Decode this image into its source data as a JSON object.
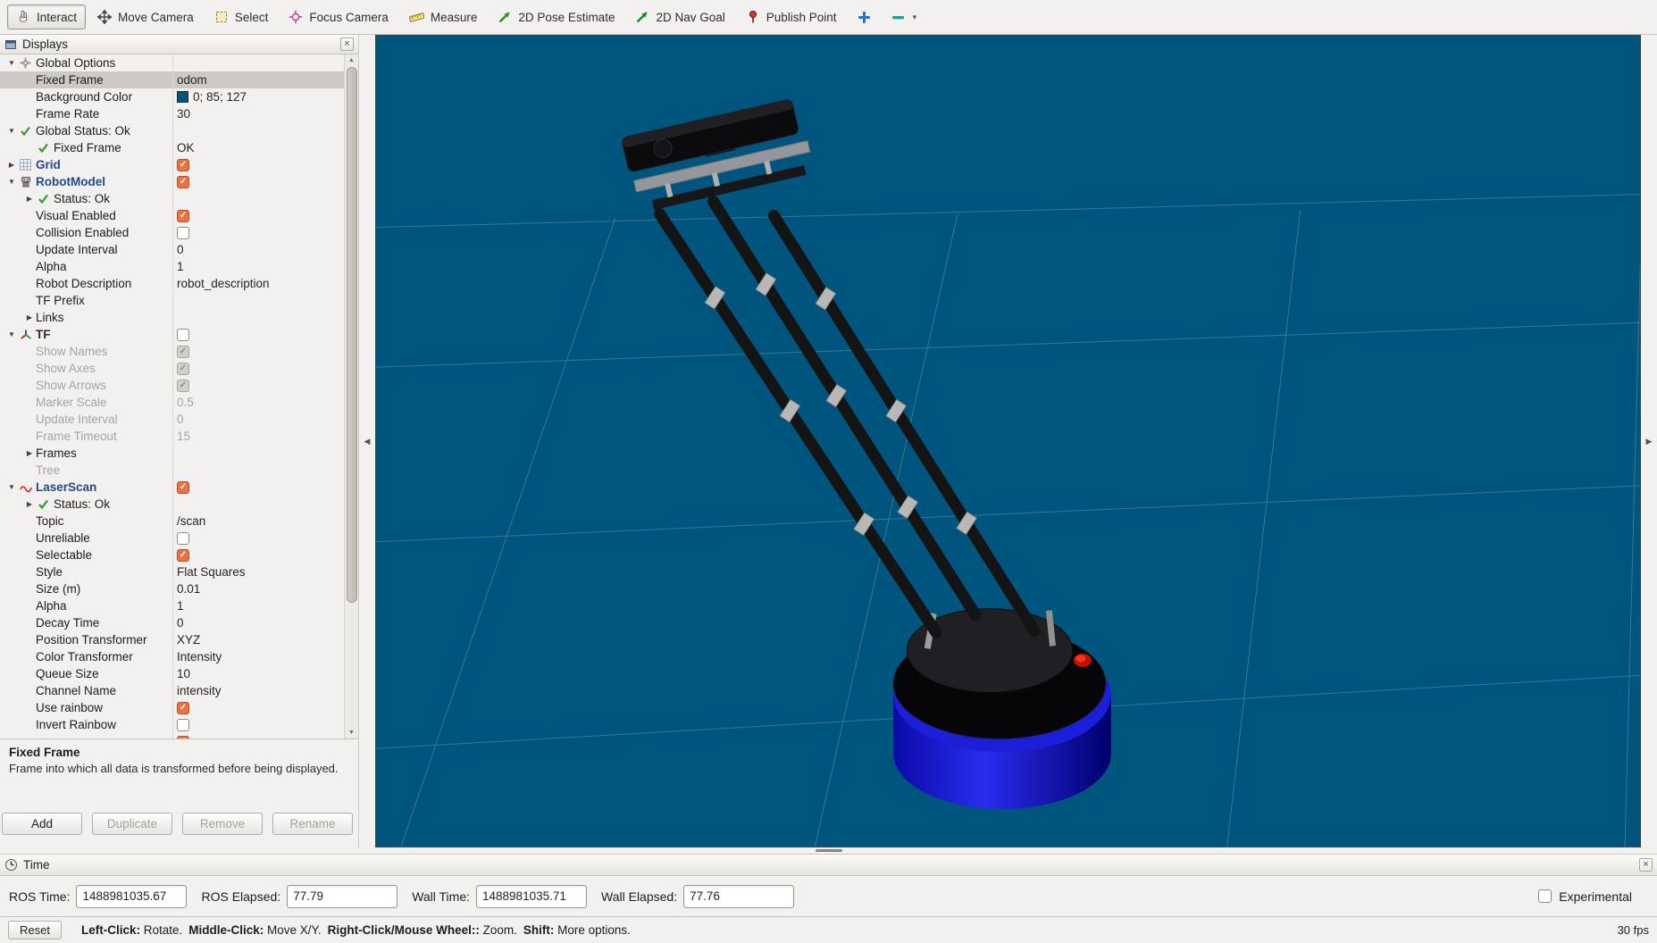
{
  "toolbar": {
    "items": [
      {
        "label": "Interact",
        "icon": "interact-icon",
        "active": true
      },
      {
        "label": "Move Camera",
        "icon": "move-camera-icon"
      },
      {
        "label": "Select",
        "icon": "select-icon"
      },
      {
        "label": "Focus Camera",
        "icon": "focus-camera-icon"
      },
      {
        "label": "Measure",
        "icon": "measure-icon"
      },
      {
        "label": "2D Pose Estimate",
        "icon": "pose-estimate-arrow-icon"
      },
      {
        "label": "2D Nav Goal",
        "icon": "nav-goal-arrow-icon"
      },
      {
        "label": "Publish Point",
        "icon": "publish-point-icon"
      },
      {
        "label": "",
        "icon": "plus-icon"
      },
      {
        "label": "",
        "icon": "minus-icon",
        "dropdown": true
      }
    ]
  },
  "displays_panel": {
    "title": "Displays",
    "rows": [
      {
        "indent": 0,
        "twisty": "open",
        "icon": "gear-icon",
        "label": "Global Options",
        "value": null
      },
      {
        "indent": 1,
        "label": "Fixed Frame",
        "value": {
          "text": "odom"
        },
        "selected": true
      },
      {
        "indent": 1,
        "label": "Background Color",
        "value": {
          "swatch": "#00557f",
          "text": "0; 85; 127"
        }
      },
      {
        "indent": 1,
        "label": "Frame Rate",
        "value": {
          "text": "30"
        }
      },
      {
        "indent": 0,
        "twisty": "open",
        "icon": "check-icon",
        "label": "Global Status: Ok",
        "value": null
      },
      {
        "indent": 1,
        "icon": "check-icon",
        "label": "Fixed Frame",
        "value": {
          "text": "OK"
        }
      },
      {
        "indent": 0,
        "twisty": "closed",
        "icon": "grid-icon",
        "label": "Grid",
        "style": "display",
        "value": {
          "checkbox": true
        }
      },
      {
        "indent": 0,
        "twisty": "open",
        "icon": "robot-icon",
        "label": "RobotModel",
        "style": "display",
        "value": {
          "checkbox": true
        }
      },
      {
        "indent": 1,
        "twisty": "closed",
        "icon": "check-icon",
        "label": "Status: Ok",
        "value": null
      },
      {
        "indent": 1,
        "label": "Visual Enabled",
        "value": {
          "checkbox": true
        }
      },
      {
        "indent": 1,
        "label": "Collision Enabled",
        "value": {
          "checkbox": false
        }
      },
      {
        "indent": 1,
        "label": "Update Interval",
        "value": {
          "text": "0"
        }
      },
      {
        "indent": 1,
        "label": "Alpha",
        "value": {
          "text": "1"
        }
      },
      {
        "indent": 1,
        "label": "Robot Description",
        "value": {
          "text": "robot_description"
        }
      },
      {
        "indent": 1,
        "label": "TF Prefix",
        "value": {
          "text": ""
        }
      },
      {
        "indent": 1,
        "twisty": "closed",
        "label": "Links",
        "value": null
      },
      {
        "indent": 0,
        "twisty": "open",
        "icon": "tf-icon",
        "label": "TF",
        "style": "display-off",
        "value": {
          "checkbox": false
        }
      },
      {
        "indent": 1,
        "label": "Show Names",
        "grayed": true,
        "value": {
          "checkbox": true,
          "grayed": true
        }
      },
      {
        "indent": 1,
        "label": "Show Axes",
        "grayed": true,
        "value": {
          "checkbox": true,
          "grayed": true
        }
      },
      {
        "indent": 1,
        "label": "Show Arrows",
        "grayed": true,
        "value": {
          "checkbox": true,
          "grayed": true
        }
      },
      {
        "indent": 1,
        "label": "Marker Scale",
        "grayed": true,
        "value": {
          "text": "0.5",
          "grayed": true
        }
      },
      {
        "indent": 1,
        "label": "Update Interval",
        "grayed": true,
        "value": {
          "text": "0",
          "grayed": true
        }
      },
      {
        "indent": 1,
        "label": "Frame Timeout",
        "grayed": true,
        "value": {
          "text": "15",
          "grayed": true
        }
      },
      {
        "indent": 1,
        "twisty": "closed",
        "label": "Frames",
        "value": null
      },
      {
        "indent": 1,
        "label": "Tree",
        "grayed": true,
        "value": null
      },
      {
        "indent": 0,
        "twisty": "open",
        "icon": "laser-icon",
        "label": "LaserScan",
        "style": "display",
        "value": {
          "checkbox": true
        }
      },
      {
        "indent": 1,
        "twisty": "closed",
        "icon": "check-icon",
        "label": "Status: Ok",
        "value": null
      },
      {
        "indent": 1,
        "label": "Topic",
        "value": {
          "text": "/scan"
        }
      },
      {
        "indent": 1,
        "label": "Unreliable",
        "value": {
          "checkbox": false
        }
      },
      {
        "indent": 1,
        "label": "Selectable",
        "value": {
          "checkbox": true
        }
      },
      {
        "indent": 1,
        "label": "Style",
        "value": {
          "text": "Flat Squares"
        }
      },
      {
        "indent": 1,
        "label": "Size (m)",
        "value": {
          "text": "0.01"
        }
      },
      {
        "indent": 1,
        "label": "Alpha",
        "value": {
          "text": "1"
        }
      },
      {
        "indent": 1,
        "label": "Decay Time",
        "value": {
          "text": "0"
        }
      },
      {
        "indent": 1,
        "label": "Position Transformer",
        "value": {
          "text": "XYZ"
        }
      },
      {
        "indent": 1,
        "label": "Color Transformer",
        "value": {
          "text": "Intensity"
        }
      },
      {
        "indent": 1,
        "label": "Queue Size",
        "value": {
          "text": "10"
        }
      },
      {
        "indent": 1,
        "label": "Channel Name",
        "value": {
          "text": "intensity"
        }
      },
      {
        "indent": 1,
        "label": "Use rainbow",
        "value": {
          "checkbox": true
        }
      },
      {
        "indent": 1,
        "label": "Invert Rainbow",
        "value": {
          "checkbox": false
        }
      },
      {
        "indent": 1,
        "label": "",
        "value": {
          "checkbox": true
        }
      }
    ],
    "help": {
      "title": "Fixed Frame",
      "body": "Frame into which all data is transformed before being displayed."
    },
    "buttons": [
      {
        "label": "Add",
        "enabled": true
      },
      {
        "label": "Duplicate",
        "enabled": false
      },
      {
        "label": "Remove",
        "enabled": false
      },
      {
        "label": "Rename",
        "enabled": false
      }
    ]
  },
  "viewport": {
    "background": "#00557f"
  },
  "time_panel": {
    "title": "Time",
    "fields": [
      {
        "label": "ROS Time:",
        "value": "1488981035.67"
      },
      {
        "label": "ROS Elapsed:",
        "value": "77.79"
      },
      {
        "label": "Wall Time:",
        "value": "1488981035.71"
      },
      {
        "label": "Wall Elapsed:",
        "value": "77.76"
      }
    ],
    "experimental_label": "Experimental"
  },
  "status_bar": {
    "reset_label": "Reset",
    "segments": [
      [
        "Left-Click:",
        " Rotate."
      ],
      [
        "Middle-Click:",
        " Move X/Y."
      ],
      [
        "Right-Click/Mouse Wheel::",
        " Zoom."
      ],
      [
        "Shift:",
        " More options."
      ]
    ],
    "fps": "30 fps"
  }
}
